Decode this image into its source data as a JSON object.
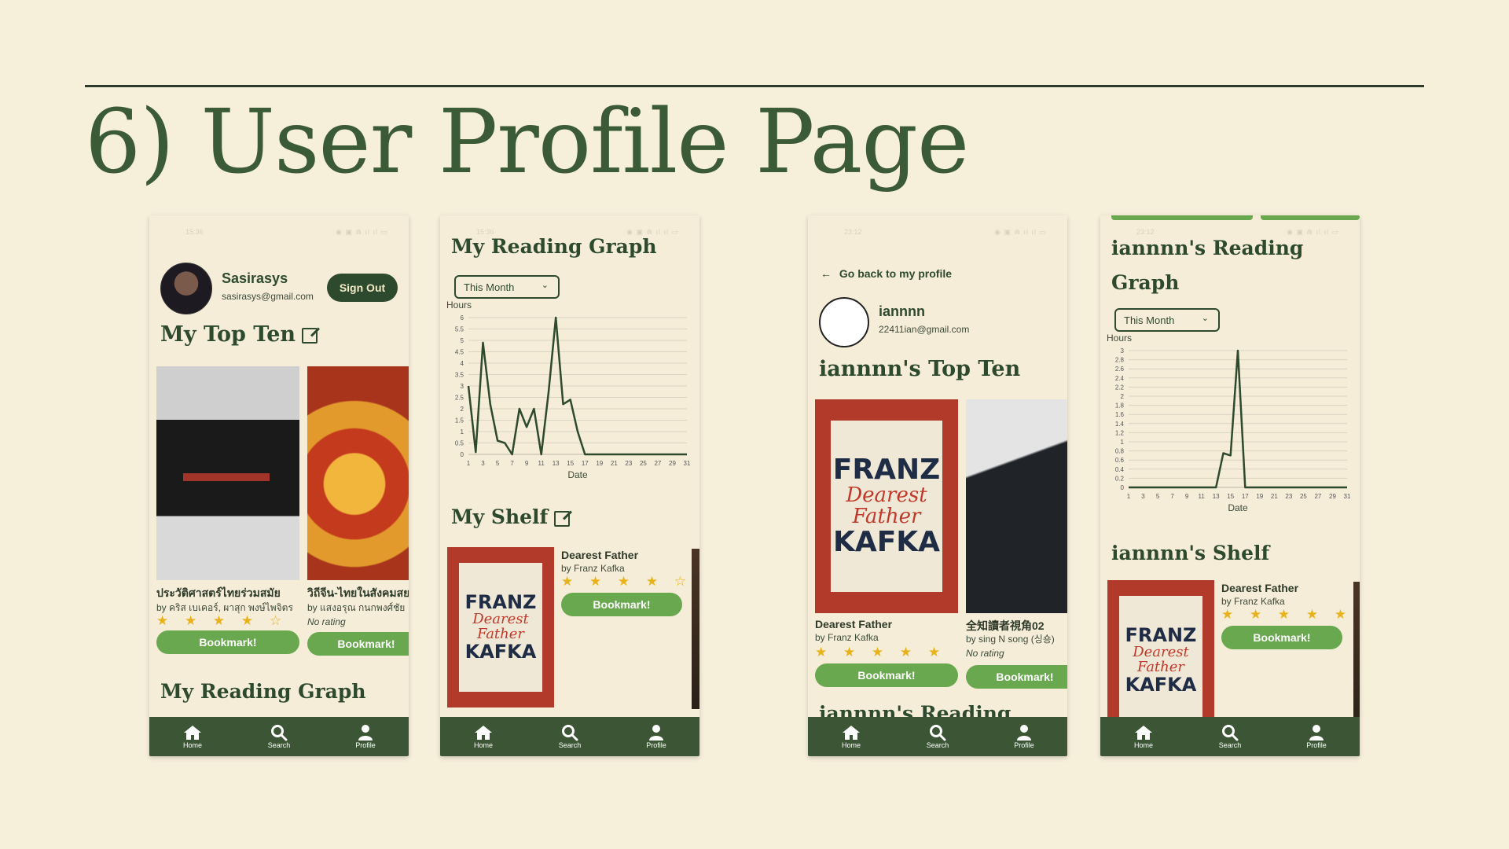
{
  "slide": {
    "title": "6) User Profile Page"
  },
  "status": {
    "time_a": "15:36",
    "time_b": "23:12",
    "signal": "◉ ▣ ⋒ ıl ıl ▭"
  },
  "nav": {
    "home": "Home",
    "search": "Search",
    "profile": "Profile"
  },
  "screen1": {
    "user_name": "Sasirasys",
    "user_email": "sasirasys@gmail.com",
    "sign_out": "Sign Out",
    "top_ten_heading": "My Top Ten",
    "reading_graph_heading": "My Reading Graph",
    "books": [
      {
        "title": "ประวัติศาสตร์ไทยร่วมสมัย",
        "author": "by คริส เบเคอร์, ผาสุก พงษ์ไพจิตร",
        "stars": "★ ★ ★ ★ ☆",
        "bookmark": "Bookmark!"
      },
      {
        "title": "วิถีจีน-ไทยในสังคมสยาม",
        "author": "by แสงอรุณ กนกพงศ์ชัย",
        "rating": "No rating",
        "bookmark": "Bookmark!"
      }
    ]
  },
  "screen2": {
    "reading_graph_heading": "My Reading Graph",
    "dropdown": "This Month",
    "shelf_heading": "My Shelf",
    "shelf_book": {
      "title": "Dearest Father",
      "author": "by Franz Kafka",
      "stars": "★ ★ ★ ★ ☆",
      "bookmark": "Bookmark!"
    }
  },
  "screen3": {
    "back": "Go back to my profile",
    "user_name": "iannnn",
    "user_email": "22411ian@gmail.com",
    "top_ten_heading": "iannnn's Top Ten",
    "reading_heading": "iannnn's Reading",
    "books": [
      {
        "title": "Dearest Father",
        "author": "by Franz Kafka",
        "stars": "★ ★ ★ ★ ★",
        "bookmark": "Bookmark!"
      },
      {
        "title": "全知讀者視角02",
        "author": "by sing N song (싱숑)",
        "rating": "No rating",
        "bookmark": "Bookmark!"
      }
    ]
  },
  "screen4": {
    "reading_graph_heading_line1": "iannnn's Reading",
    "reading_graph_heading_line2": "Graph",
    "dropdown": "This Month",
    "shelf_heading": "iannnn's Shelf",
    "shelf_book": {
      "title": "Dearest Father",
      "author": "by Franz Kafka",
      "stars": "★ ★ ★ ★ ★",
      "bookmark": "Bookmark!"
    }
  },
  "cover_text": {
    "franz": "FRANZ",
    "dearest": "Dearest",
    "father": "Father",
    "kafka": "KAFKA"
  },
  "chart_data": [
    {
      "type": "line",
      "ylabel": "Hours",
      "xlabel": "Date",
      "x": [
        1,
        2,
        3,
        4,
        5,
        6,
        7,
        8,
        9,
        10,
        11,
        12,
        13,
        14,
        15,
        16,
        17,
        18,
        19,
        20,
        21,
        22,
        23,
        24,
        25,
        26,
        27,
        28,
        29,
        30,
        31
      ],
      "x_ticks": [
        1,
        3,
        5,
        7,
        9,
        11,
        13,
        15,
        17,
        19,
        21,
        23,
        25,
        27,
        29,
        31
      ],
      "y_ticks": [
        0,
        0.5,
        1,
        1.5,
        2,
        2.5,
        3,
        3.5,
        4,
        4.5,
        5,
        5.5,
        6
      ],
      "ylim": [
        0,
        6
      ],
      "series": [
        {
          "values": [
            3,
            0.1,
            4.9,
            2.2,
            0.6,
            0.5,
            0,
            2,
            1.2,
            2,
            0,
            2.7,
            6,
            2.2,
            2.4,
            1,
            0,
            0,
            0,
            0,
            0,
            0,
            0,
            0,
            0,
            0,
            0,
            0,
            0,
            0,
            0
          ]
        }
      ],
      "line_color": "#2e4a2e",
      "grid": true
    },
    {
      "type": "line",
      "ylabel": "Hours",
      "xlabel": "Date",
      "x": [
        1,
        2,
        3,
        4,
        5,
        6,
        7,
        8,
        9,
        10,
        11,
        12,
        13,
        14,
        15,
        16,
        17,
        18,
        19,
        20,
        21,
        22,
        23,
        24,
        25,
        26,
        27,
        28,
        29,
        30,
        31
      ],
      "x_ticks": [
        1,
        3,
        5,
        7,
        9,
        11,
        13,
        15,
        17,
        19,
        21,
        23,
        25,
        27,
        29,
        31
      ],
      "y_ticks": [
        0,
        0.2,
        0.4,
        0.6,
        0.8,
        1,
        1.2,
        1.4,
        1.6,
        1.8,
        2,
        2.2,
        2.4,
        2.6,
        2.8,
        3
      ],
      "ylim": [
        0,
        3
      ],
      "series": [
        {
          "values": [
            0,
            0,
            0,
            0,
            0,
            0,
            0,
            0,
            0,
            0,
            0,
            0,
            0,
            0.75,
            0.7,
            3,
            0,
            0,
            0,
            0,
            0,
            0,
            0,
            0,
            0,
            0,
            0,
            0,
            0,
            0,
            0
          ]
        }
      ],
      "line_color": "#2e4a2e",
      "grid": true
    }
  ]
}
